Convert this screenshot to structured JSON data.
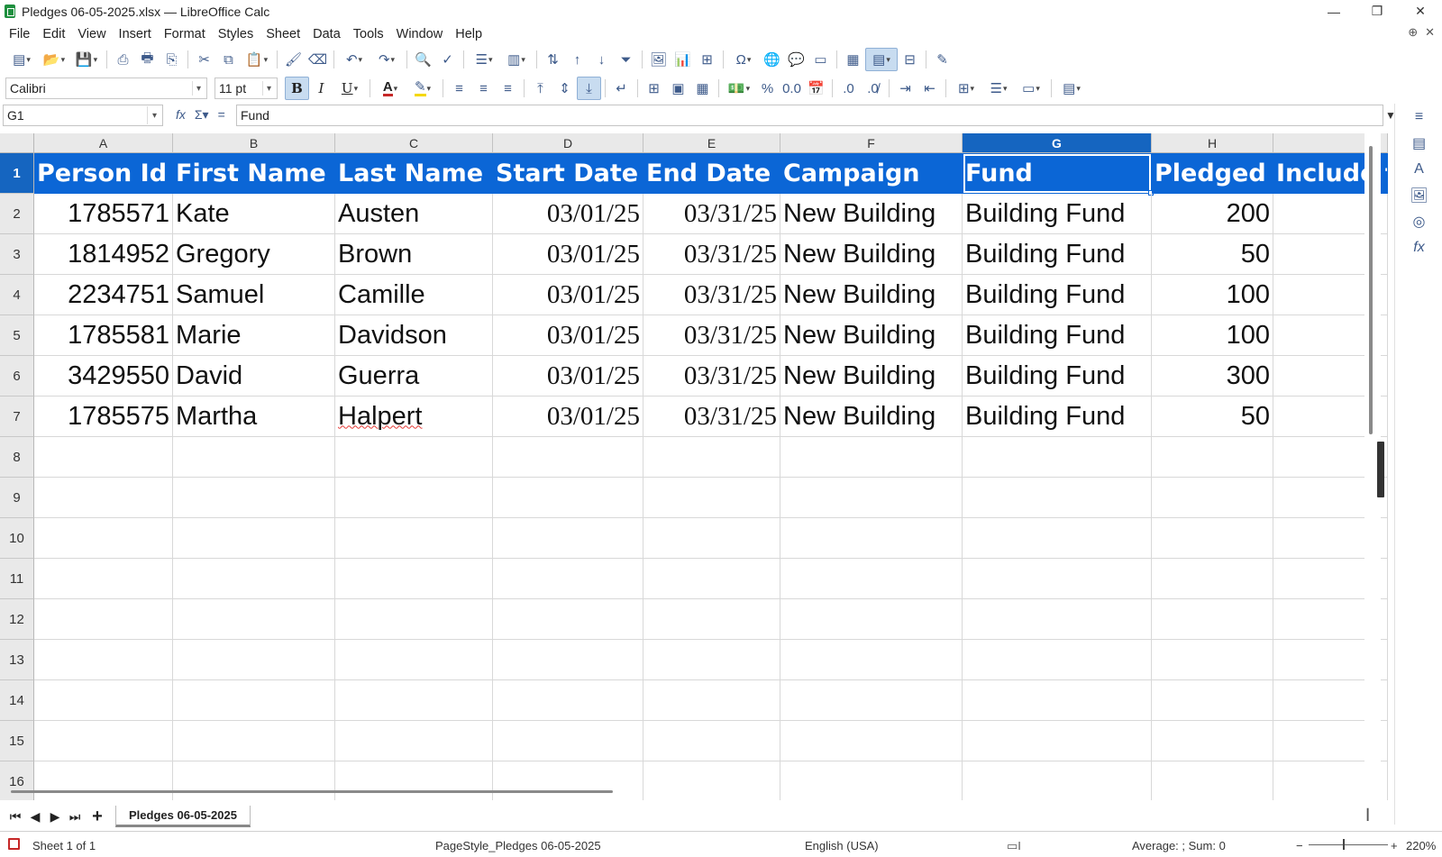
{
  "window": {
    "title": "Pledges 06-05-2025.xlsx — LibreOffice Calc",
    "min": "—",
    "max": "❐",
    "close": "✕"
  },
  "menu": {
    "items": [
      "File",
      "Edit",
      "View",
      "Insert",
      "Format",
      "Styles",
      "Sheet",
      "Data",
      "Tools",
      "Window",
      "Help"
    ]
  },
  "format_toolbar": {
    "font_name": "Calibri",
    "font_size": "11 pt"
  },
  "formula_bar": {
    "cell_ref": "G1",
    "content": "Fund"
  },
  "columns": [
    "A",
    "B",
    "C",
    "D",
    "E",
    "F",
    "G",
    "H",
    ""
  ],
  "selected_column": "G",
  "rows": [
    "1",
    "2",
    "3",
    "4",
    "5",
    "6",
    "7",
    "8",
    "9",
    "10",
    "11",
    "12",
    "13",
    "14",
    "15",
    "16"
  ],
  "selected_row": "1",
  "sheet": {
    "header": [
      "Person Id",
      "First Name",
      "Last Name",
      "Start Date",
      "End Date",
      "Campaign",
      "Fund",
      "Pledged",
      "Include fa"
    ],
    "data": [
      [
        "1785571",
        "Kate",
        "Austen",
        "03/01/25",
        "03/31/25",
        "New Building",
        "Building Fund",
        "200",
        ""
      ],
      [
        "1814952",
        "Gregory",
        "Brown",
        "03/01/25",
        "03/31/25",
        "New Building",
        "Building Fund",
        "50",
        ""
      ],
      [
        "2234751",
        "Samuel",
        "Camille",
        "03/01/25",
        "03/31/25",
        "New Building",
        "Building Fund",
        "100",
        ""
      ],
      [
        "1785581",
        "Marie",
        "Davidson",
        "03/01/25",
        "03/31/25",
        "New Building",
        "Building Fund",
        "100",
        ""
      ],
      [
        "3429550",
        "David",
        "Guerra",
        "03/01/25",
        "03/31/25",
        "New Building",
        "Building Fund",
        "300",
        ""
      ],
      [
        "1785575",
        "Martha",
        "Halpert",
        "03/01/25",
        "03/31/25",
        "New Building",
        "Building Fund",
        "50",
        ""
      ]
    ]
  },
  "tabs": {
    "active": "Pledges 06-05-2025"
  },
  "status": {
    "sheet_info": "Sheet 1 of 1",
    "page_style": "PageStyle_Pledges 06-05-2025",
    "language": "English (USA)",
    "summary": "Average: ; Sum: 0",
    "zoom": "220%",
    "zoom_minus": "−",
    "zoom_plus": "+"
  },
  "colors": {
    "header_fill": "#0b66d6",
    "selection": "#1565c0",
    "brand_green": "#1e8f3e"
  }
}
